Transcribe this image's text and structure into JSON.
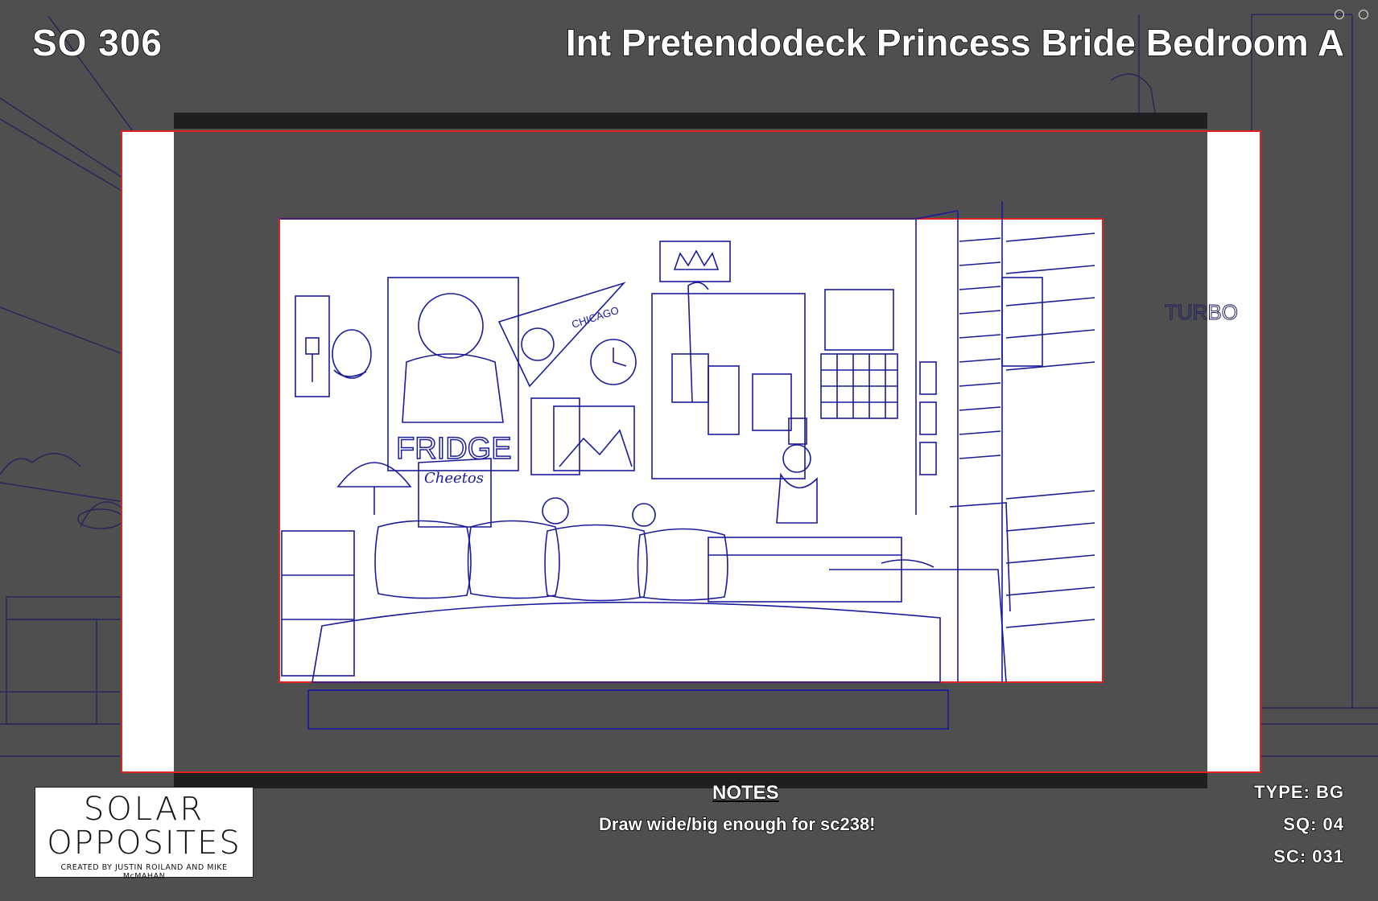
{
  "header": {
    "episode_code": "SO 306",
    "scene_title": "Int Pretendodeck Princess Bride Bedroom A"
  },
  "artwork": {
    "poster_fridge_text": "FRIDGE",
    "chips_bag_text": "Cheetos",
    "pennant_text": "CHICAGO",
    "poster_turbo_text": "TURBO",
    "line_color": "#1a1a9c",
    "safe_frame_color": "#e52020"
  },
  "logo": {
    "line1": "SOLAR",
    "line2": "OPPOSITES",
    "credit": "CREATED BY JUSTIN ROILAND AND MIKE McMAHAN"
  },
  "notes": {
    "heading": "NOTES",
    "text": "Draw wide/big enough for sc238!"
  },
  "meta": {
    "type_line": "TYPE:  BG",
    "sq_line": "SQ:  04",
    "sc_line": "SC:  031"
  }
}
